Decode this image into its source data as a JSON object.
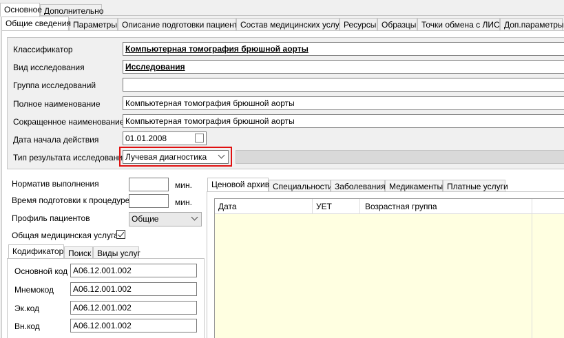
{
  "top_tabs": [
    "Основное",
    "Дополнительно"
  ],
  "second_tabs": [
    "Общие сведения",
    "Параметры",
    "Описание подготовки пациента",
    "Состав медицинских услуг",
    "Ресурсы",
    "Образцы",
    "Точки обмена с ЛИС",
    "Доп.параметры"
  ],
  "form": {
    "classifier_label": "Классификатор",
    "classifier_value": "Компьютерная томография брюшной аорты",
    "study_type_label": "Вид исследования",
    "study_type_value": "Исследования",
    "study_group_label": "Группа исследований",
    "study_group_value": "",
    "full_name_label": "Полное наименование",
    "full_name_value": "Компьютерная томография брюшной аорты",
    "short_name_label": "Сокращенное наименование",
    "short_name_value": "Компьютерная томография брюшной аорты",
    "start_date_label": "Дата начала действия",
    "start_date_value": "01.01.2008",
    "result_type_label": "Тип результата исследования",
    "result_type_value": "Лучевая диагностика"
  },
  "params": {
    "norm_label": "Норматив выполнения",
    "norm_unit": "мин.",
    "prep_label": "Время подготовки к процедуре",
    "prep_unit": "мин.",
    "profile_label": "Профиль пациентов",
    "profile_value": "Общие",
    "common_label": "Общая медицинская услуга",
    "common_checked": true
  },
  "code_tabs": [
    "Кодификатор",
    "Поиск",
    "Виды услуг"
  ],
  "codes": [
    {
      "label": "Основной код",
      "value": "A06.12.001.002"
    },
    {
      "label": "Мнемокод",
      "value": "A06.12.001.002"
    },
    {
      "label": "Эк.код",
      "value": "A06.12.001.002"
    },
    {
      "label": "Вн.код",
      "value": "A06.12.001.002"
    }
  ],
  "right_tabs": [
    "Ценовой архив",
    "Специальности",
    "Заболевания",
    "Медикаменты",
    "Платные услуги"
  ],
  "grid": {
    "columns": [
      "Дата",
      "УЕТ",
      "Возрастная группа"
    ]
  },
  "colors": {
    "highlight": "#e01010",
    "grid_bg": "#ffffe1"
  }
}
